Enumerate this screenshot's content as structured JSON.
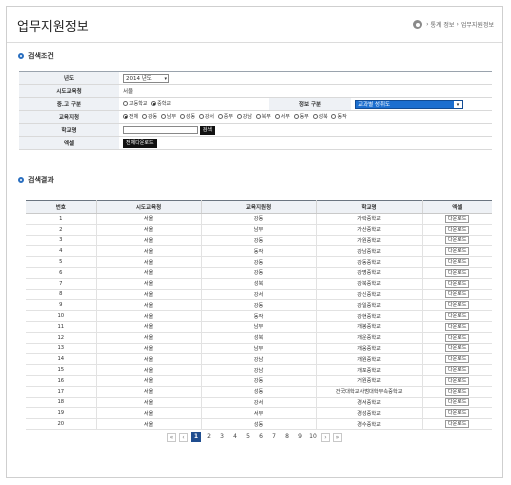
{
  "header": {
    "title": "업무지원정보",
    "breadcrumb": [
      "통계 정보",
      "업무지원정보"
    ]
  },
  "search": {
    "section_title": "검색조건",
    "year_label": "년도",
    "year_value": "2014 년도",
    "office_label": "시도교육청",
    "office_value": "서울",
    "school_type_label": "중.고 구분",
    "school_type_options": [
      "고등학교",
      "중학교"
    ],
    "school_type_selected": "중학교",
    "info_type_label": "정보 구분",
    "info_type_value": "교과별 성취도",
    "district_label": "교육지청",
    "district_options": [
      "전체",
      "강동",
      "남부",
      "성동",
      "강서",
      "중부",
      "강남",
      "북부",
      "서부",
      "동부",
      "성북",
      "동작"
    ],
    "district_selected": "전체",
    "school_label": "학교명",
    "school_placeholder": "",
    "search_button": "검색",
    "excel_label": "엑셀",
    "download_all_button": "전체다운로드"
  },
  "results": {
    "section_title": "검색결과",
    "columns": [
      "번호",
      "시도교육청",
      "교육지원청",
      "학교명",
      "엑셀"
    ],
    "download_label": "다운로드",
    "rows": [
      [
        "1",
        "서울",
        "강동",
        "가락중학교"
      ],
      [
        "2",
        "서울",
        "남부",
        "가산중학교"
      ],
      [
        "3",
        "서울",
        "강동",
        "가원중학교"
      ],
      [
        "4",
        "서울",
        "동작",
        "강남중학교"
      ],
      [
        "5",
        "서울",
        "강동",
        "강동중학교"
      ],
      [
        "6",
        "서울",
        "강동",
        "강명중학교"
      ],
      [
        "7",
        "서울",
        "성북",
        "강북중학교"
      ],
      [
        "8",
        "서울",
        "강서",
        "강신중학교"
      ],
      [
        "9",
        "서울",
        "강동",
        "강일중학교"
      ],
      [
        "10",
        "서울",
        "동작",
        "강현중학교"
      ],
      [
        "11",
        "서울",
        "남부",
        "개봉중학교"
      ],
      [
        "12",
        "서울",
        "성북",
        "개운중학교"
      ],
      [
        "13",
        "서울",
        "남부",
        "개웅중학교"
      ],
      [
        "14",
        "서울",
        "강남",
        "개원중학교"
      ],
      [
        "15",
        "서울",
        "강남",
        "개포중학교"
      ],
      [
        "16",
        "서울",
        "강동",
        "거원중학교"
      ],
      [
        "17",
        "서울",
        "성동",
        "건국대학교사범대학부속중학교"
      ],
      [
        "18",
        "서울",
        "강서",
        "경서중학교"
      ],
      [
        "19",
        "서울",
        "서부",
        "경성중학교"
      ],
      [
        "20",
        "서울",
        "성동",
        "경수중학교"
      ]
    ]
  },
  "pagination": {
    "first": "«",
    "prev": "‹",
    "next": "›",
    "last": "»",
    "pages": [
      "1",
      "2",
      "3",
      "4",
      "5",
      "6",
      "7",
      "8",
      "9",
      "10"
    ],
    "current": "1"
  },
  "colors": {
    "accent": "#1f4d8f",
    "select_blue": "#1c6fd0",
    "label_bg": "#eef1f5"
  }
}
